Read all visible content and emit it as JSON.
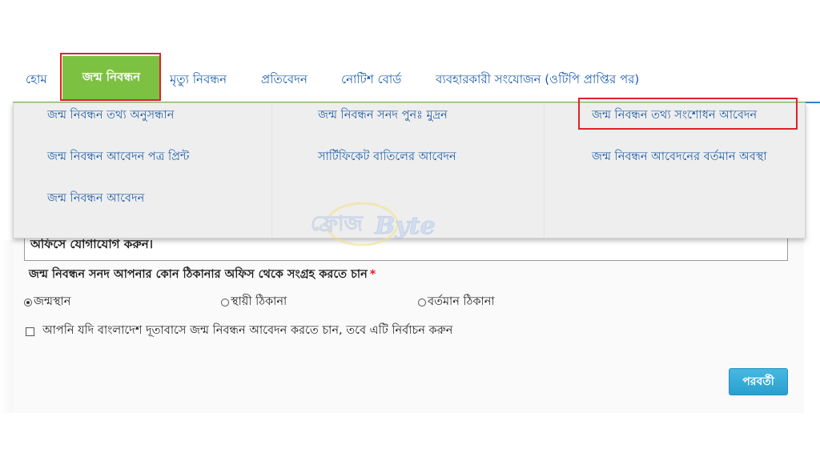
{
  "nav": {
    "items": [
      {
        "label": "হোম"
      },
      {
        "label": "জন্ম নিবন্ধন"
      },
      {
        "label": "মৃত্যু নিবন্ধন"
      },
      {
        "label": "প্রতিবেদন"
      },
      {
        "label": "নোটিশ বোর্ড"
      },
      {
        "label": "ব্যবহারকারী সংযোজন (ওটিপি প্রাপ্তির পর)"
      }
    ]
  },
  "dropdown": {
    "items": [
      {
        "label": "জন্ম নিবন্ধন তথ্য অনুসন্ধান"
      },
      {
        "label": "জন্ম নিবন্ধন সনদ পুনঃ মুদ্রন"
      },
      {
        "label": "জন্ম নিবন্ধন তথ্য সংশোধন আবেদন"
      },
      {
        "label": "জন্ম নিবন্ধন আবেদন পত্র প্রিন্ট"
      },
      {
        "label": "সার্টিফিকেট বাতিলের আবেদন"
      },
      {
        "label": "জন্ম নিবন্ধন আবেদনের বর্তমান অবস্থা"
      },
      {
        "label": "জন্ম নিবন্ধন আবেদন"
      }
    ]
  },
  "watermark": {
    "text": "ফ্রোজByte"
  },
  "form": {
    "notice_partial": "অফিসে যোগাযোগ করুন।",
    "question": "জন্ম নিবন্ধন সনদ আপনার কোন ঠিকানার অফিস থেকে সংগ্রহ করতে চান",
    "required_mark": "*",
    "radios": [
      {
        "label": "জন্মস্থান",
        "selected": true
      },
      {
        "label": "স্থায়ী ঠিকানা",
        "selected": false
      },
      {
        "label": "বর্তমান ঠিকানা",
        "selected": false
      }
    ],
    "embassy_checkbox": "আপনি যদি বাংলাদেশ দূতাবাসে জন্ম নিবন্ধন আবেদন করতে চান, তবে এটি নির্বাচন করুন",
    "next_button": "পরবর্তী"
  },
  "colors": {
    "accent_green": "#7cc142",
    "link_blue": "#1f5ea8",
    "highlight_red": "#e0202a",
    "button_blue": "#2a9fd0"
  }
}
